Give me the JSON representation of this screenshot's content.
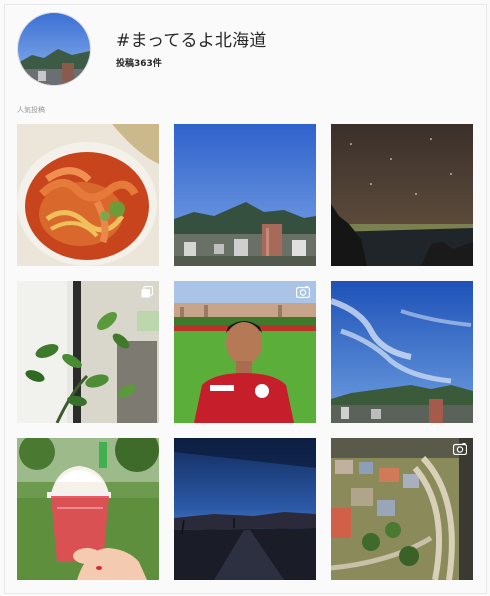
{
  "header": {
    "title": "#まってるよ北海道",
    "post_count": "投稿363件"
  },
  "section": {
    "label": "人気投稿"
  },
  "posts": [
    {
      "name": "ramen",
      "icons": []
    },
    {
      "name": "city-mountain",
      "icons": []
    },
    {
      "name": "night-sky",
      "icons": []
    },
    {
      "name": "plant",
      "icons": [
        "multiple-photos-icon"
      ]
    },
    {
      "name": "soccer-player",
      "icons": [
        "video-icon"
      ]
    },
    {
      "name": "blue-sky",
      "icons": []
    },
    {
      "name": "shaved-ice",
      "icons": []
    },
    {
      "name": "sunset-road",
      "icons": []
    },
    {
      "name": "model-railway",
      "icons": [
        "video-icon"
      ]
    }
  ]
}
